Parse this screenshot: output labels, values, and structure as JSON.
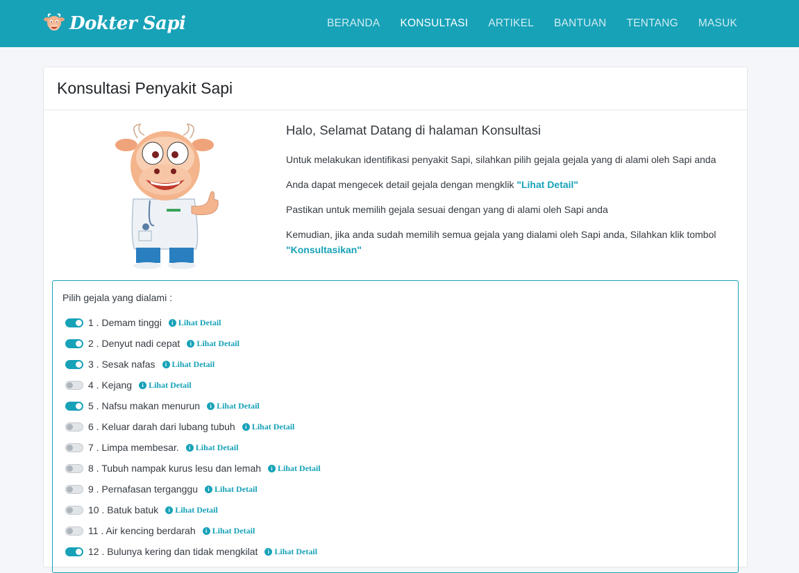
{
  "brand": {
    "name": "Dokter Sapi",
    "logo_icon": "cow-face-icon"
  },
  "nav": {
    "items": [
      {
        "label": "BERANDA",
        "active": false
      },
      {
        "label": "KONSULTASI",
        "active": true
      },
      {
        "label": "ARTIKEL",
        "active": false
      },
      {
        "label": "BANTUAN",
        "active": false
      },
      {
        "label": "TENTANG",
        "active": false
      },
      {
        "label": "MASUK",
        "active": false
      }
    ]
  },
  "card": {
    "title": "Konsultasi Penyakit Sapi",
    "mascot_icon": "cow-doctor-mascot",
    "intro": {
      "heading": "Halo, Selamat Datang di halaman Konsultasi",
      "p1": "Untuk melakukan identifikasi penyakit Sapi, silahkan pilih gejala gejala yang di alami oleh Sapi anda",
      "p2_prefix": "Anda dapat mengecek detail gejala dengan mengklik ",
      "p2_highlight": "\"Lihat Detail\"",
      "p3": "Pastikan untuk memilih gejala sesuai dengan yang di alami oleh Sapi anda",
      "p4_prefix": "Kemudian, jika anda sudah memilih semua gejala yang dialami oleh Sapi anda, Silahkan klik tombol ",
      "p4_highlight": "\"Konsultasikan\""
    }
  },
  "symptoms": {
    "label": "Pilih gejala yang dialami :",
    "detail_label": "Lihat Detail",
    "items": [
      {
        "text": "1 . Demam tinggi",
        "checked": true
      },
      {
        "text": "2 . Denyut nadi cepat",
        "checked": true
      },
      {
        "text": "3 . Sesak nafas",
        "checked": true
      },
      {
        "text": "4 . Kejang",
        "checked": false
      },
      {
        "text": "5 . Nafsu makan menurun",
        "checked": true
      },
      {
        "text": "6 . Keluar darah dari lubang tubuh",
        "checked": false
      },
      {
        "text": "7 . Limpa membesar.",
        "checked": false
      },
      {
        "text": "8 . Tubuh nampak kurus lesu dan lemah",
        "checked": false
      },
      {
        "text": "9 . Pernafasan terganggu",
        "checked": false
      },
      {
        "text": "10 . Batuk batuk",
        "checked": false
      },
      {
        "text": "11 . Air kencing berdarah",
        "checked": false
      },
      {
        "text": "12 . Bulunya kering dan tidak mengkilat",
        "checked": true
      }
    ]
  },
  "colors": {
    "primary": "#17a2b8",
    "background": "#f4f6f9"
  }
}
